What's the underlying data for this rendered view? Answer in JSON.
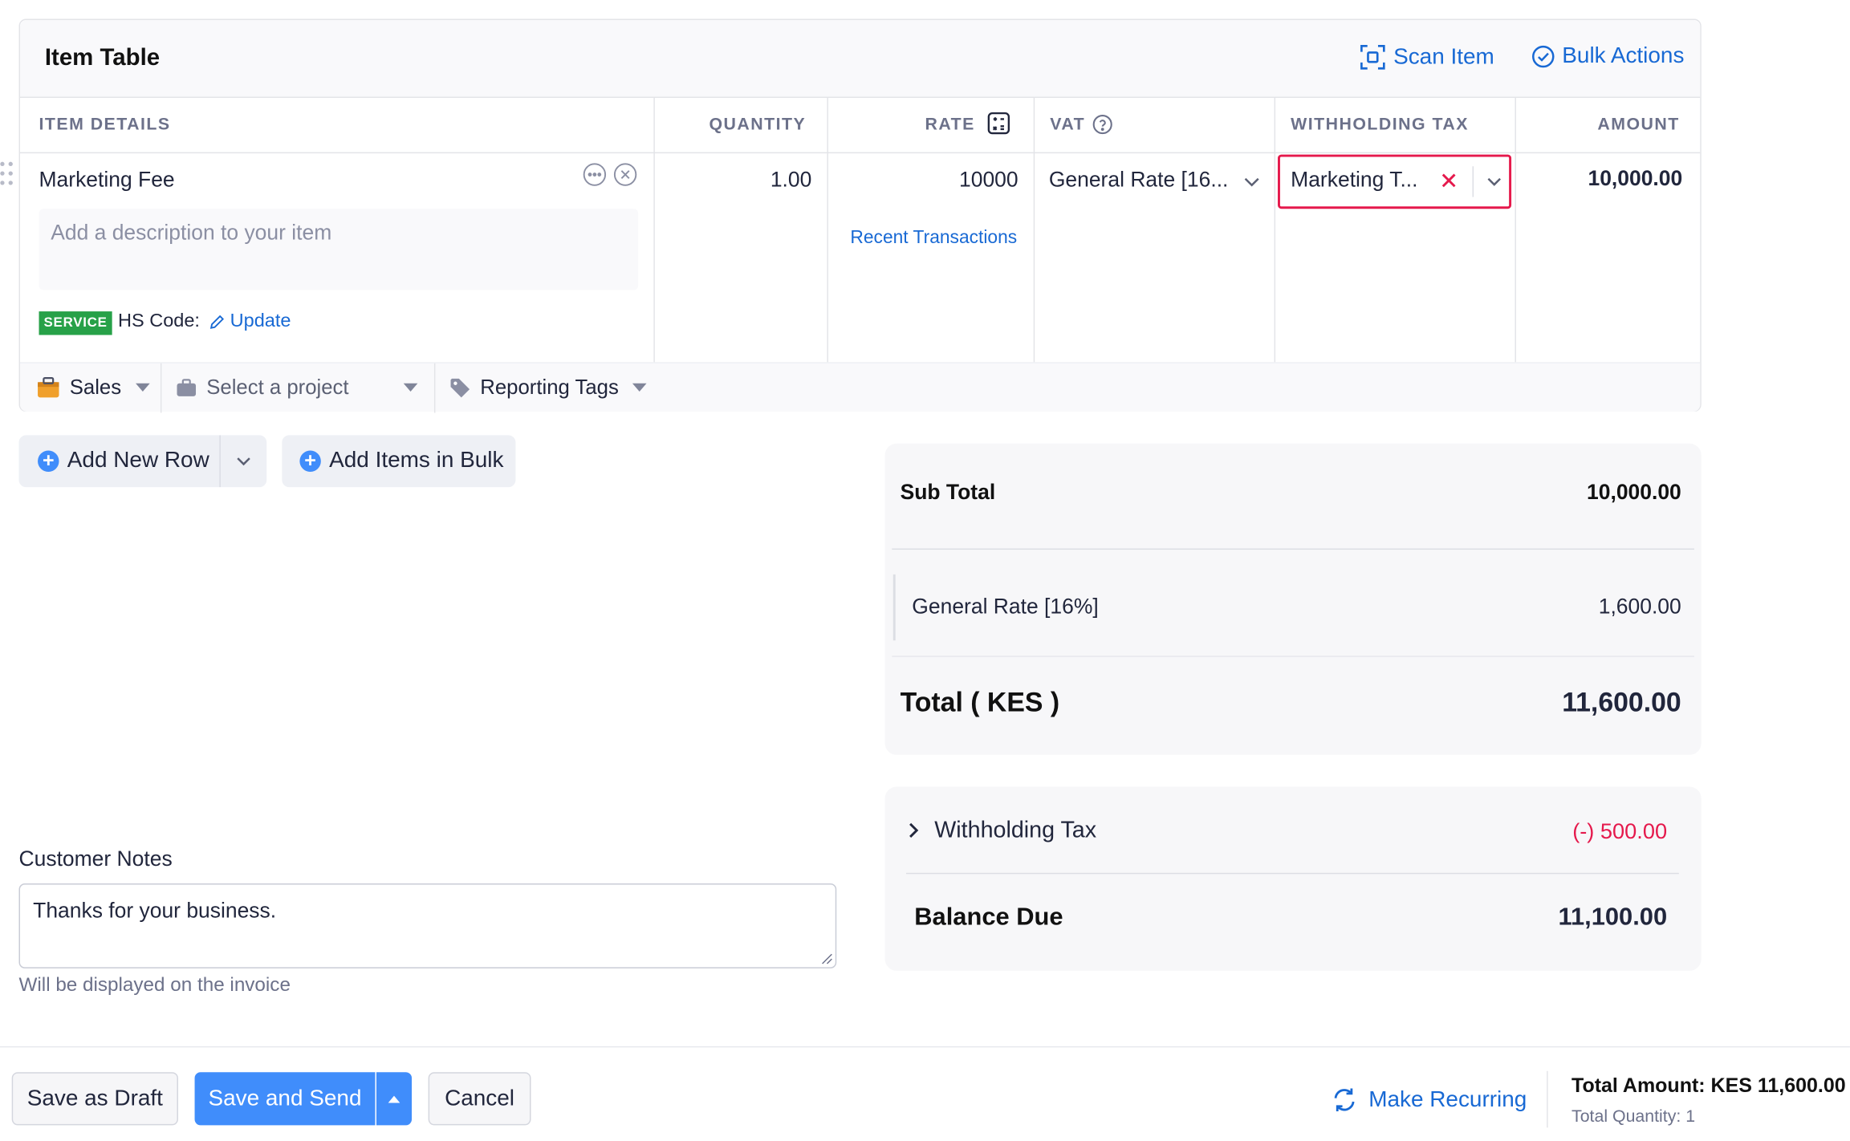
{
  "item_table": {
    "title": "Item Table",
    "scan_item": "Scan Item",
    "bulk_actions": "Bulk Actions",
    "columns": [
      "ITEM DETAILS",
      "QUANTITY",
      "RATE",
      "VAT",
      "WITHHOLDING TAX",
      "AMOUNT"
    ],
    "row": {
      "item_name": "Marketing Fee",
      "description_placeholder": "Add a description to your item",
      "badge": "SERVICE",
      "hs_code_label": "HS Code:",
      "hs_code_action": "Update",
      "quantity": "1.00",
      "rate": "10000",
      "recent_transactions": "Recent Transactions",
      "vat": "General Rate [16...",
      "withholding_tax": "Marketing T...",
      "amount": "10,000.00"
    },
    "strip": {
      "account": "Sales",
      "project_placeholder": "Select a project",
      "reporting_tags": "Reporting Tags"
    }
  },
  "row_actions": {
    "add_new_row": "Add New Row",
    "add_items_bulk": "Add Items in Bulk"
  },
  "totals": {
    "sub_total_label": "Sub Total",
    "sub_total_value": "10,000.00",
    "tax_label": "General Rate [16%]",
    "tax_value": "1,600.00",
    "total_label": "Total ( KES )",
    "total_value": "11,600.00"
  },
  "withholding": {
    "label": "Withholding Tax",
    "value": "(-) 500.00",
    "balance_label": "Balance Due",
    "balance_value": "11,100.00"
  },
  "notes": {
    "label": "Customer Notes",
    "value": "Thanks for your business.",
    "help": "Will be displayed on the invoice"
  },
  "footer": {
    "save_draft": "Save as Draft",
    "save_send": "Save and Send",
    "cancel": "Cancel",
    "make_recurring": "Make Recurring",
    "total_amount": "Total Amount: KES 11,600.00",
    "total_quantity": "Total Quantity: 1"
  },
  "colors": {
    "accent": "#408dfb",
    "link": "#1869d4",
    "danger": "#e5194c",
    "badge": "#27a148"
  }
}
